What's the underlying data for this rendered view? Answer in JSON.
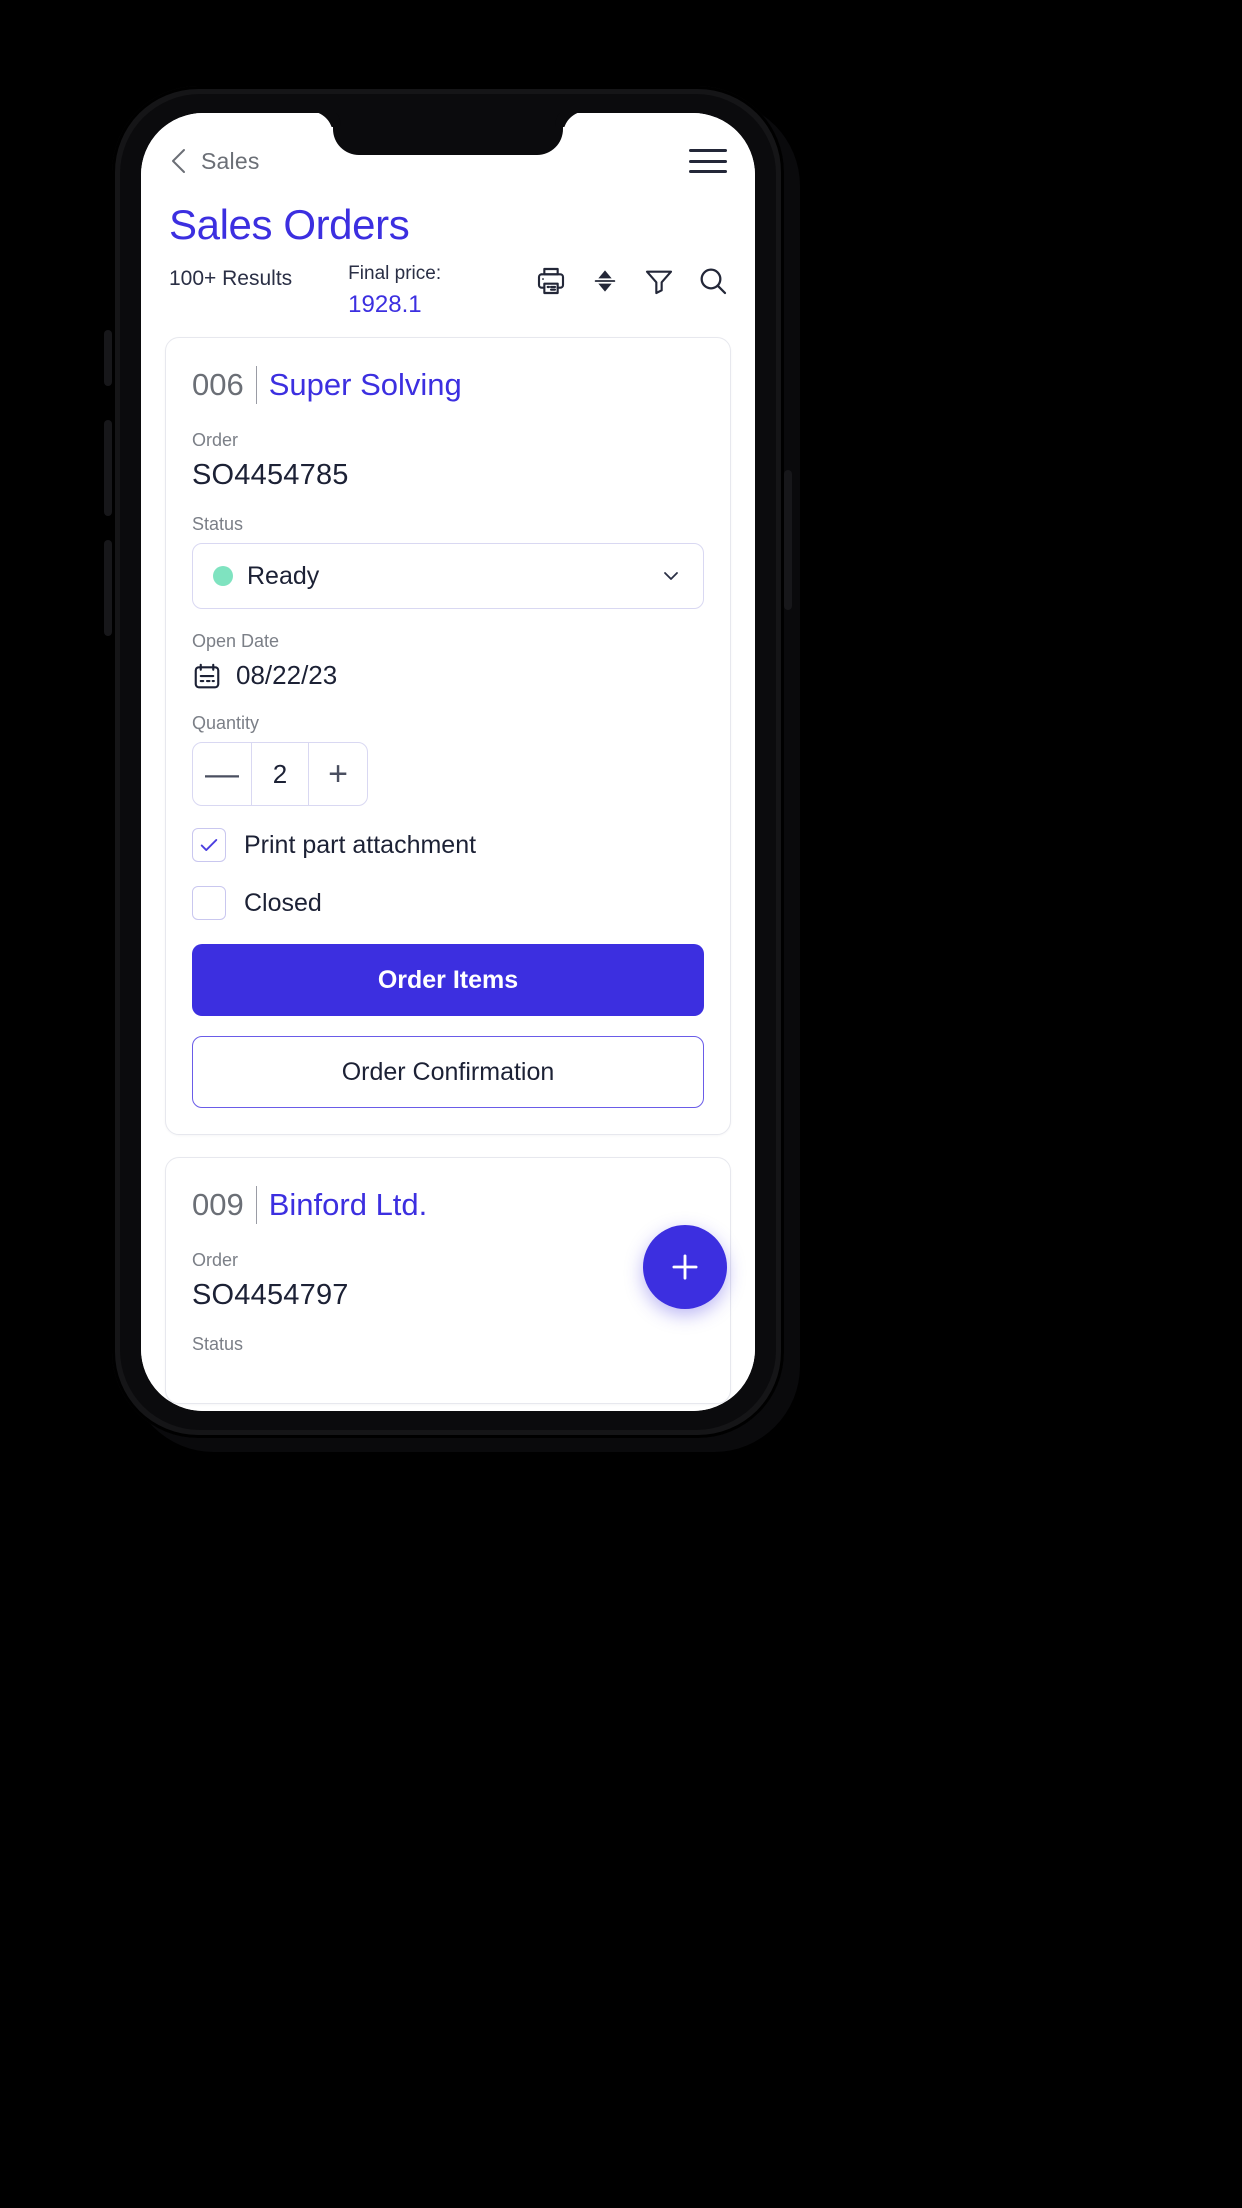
{
  "nav": {
    "back_icon": "chevron-left-icon",
    "title": "Sales",
    "menu_icon": "hamburger-menu-icon"
  },
  "header": {
    "page_title": "Sales Orders",
    "results_count": "100+ Results",
    "final_price_label": "Final  price:",
    "final_price_value": "1928.1",
    "tools": [
      {
        "name": "print-icon",
        "label": "Print"
      },
      {
        "name": "sort-icon",
        "label": "Sort"
      },
      {
        "name": "filter-icon",
        "label": "Filter"
      },
      {
        "name": "search-icon",
        "label": "Search"
      }
    ]
  },
  "colors": {
    "accent": "#3c2fe0",
    "status_ready": "#7fe3c0",
    "text_dark": "#1c2135",
    "text_muted": "#7b7f87",
    "border": "#d9d8f2",
    "card_border": "#e7e8ee"
  },
  "cards": [
    {
      "number": "006",
      "customer": "Super Solving",
      "order_label": "Order",
      "order_value": "SO4454785",
      "status_label": "Status",
      "status_value": "Ready",
      "status_dot_color": "#7fe3c0",
      "open_date_label": "Open Date",
      "open_date_value": "08/22/23",
      "quantity_label": "Quantity",
      "quantity_value": "2",
      "decrement_symbol": "—",
      "increment_symbol": "+",
      "checkbox_print_label": "Print part attachment",
      "checkbox_print_checked": true,
      "checkbox_closed_label": "Closed",
      "checkbox_closed_checked": false,
      "primary_button": "Order Items",
      "secondary_button": "Order Confirmation"
    },
    {
      "number": "009",
      "customer": "Binford Ltd.",
      "order_label": "Order",
      "order_value": "SO4454797",
      "status_label": "Status"
    }
  ],
  "fab": {
    "icon": "plus-icon",
    "label": "Add"
  }
}
